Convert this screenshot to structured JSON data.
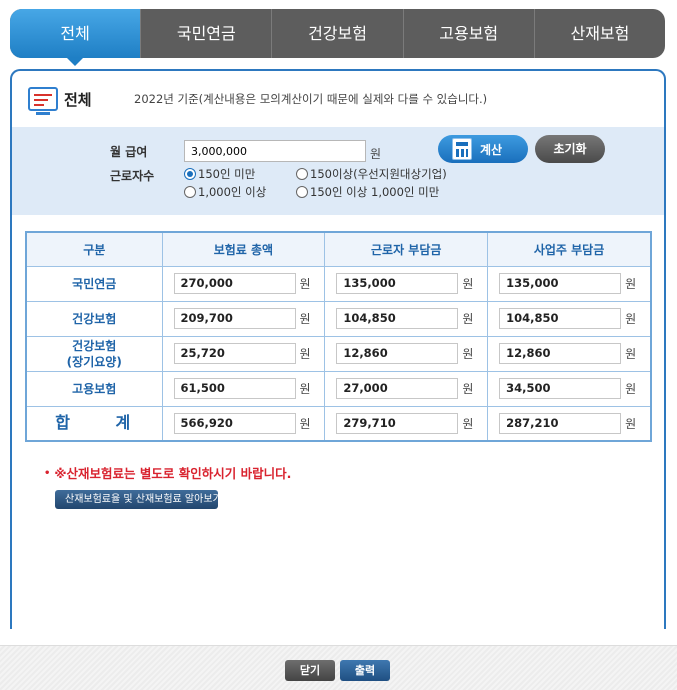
{
  "tabs": [
    {
      "label": "전체",
      "active": true
    },
    {
      "label": "국민연금"
    },
    {
      "label": "건강보험"
    },
    {
      "label": "고용보험"
    },
    {
      "label": "산재보험"
    }
  ],
  "panel": {
    "title": "전체",
    "note": "2022년 기준(계산내용은 모의계산이기 때문에 실제와 다를 수 있습니다.)"
  },
  "form": {
    "salary_label": "월 급여",
    "salary_value": "3,000,000",
    "currency": "원",
    "workers_label": "근로자수",
    "options": [
      {
        "label": "150인 미만",
        "checked": true
      },
      {
        "label": "150이상(우선지원대상기업)",
        "checked": false
      },
      {
        "label": "1,000인 이상",
        "checked": false
      },
      {
        "label": "150인 이상 1,000인 미만",
        "checked": false
      }
    ],
    "calc_button": "계산",
    "reset_button": "초기화"
  },
  "table": {
    "headers": [
      "구분",
      "보험료 총액",
      "근로자 부담금",
      "사업주 부담금"
    ],
    "unit": "원",
    "rows": [
      {
        "name": "국민연금",
        "total": "270,000",
        "worker": "135,000",
        "employer": "135,000"
      },
      {
        "name": "건강보험",
        "total": "209,700",
        "worker": "104,850",
        "employer": "104,850"
      },
      {
        "name": "건강보험",
        "sub": "(장기요양)",
        "total": "25,720",
        "worker": "12,860",
        "employer": "12,860"
      },
      {
        "name": "고용보험",
        "total": "61,500",
        "worker": "27,000",
        "employer": "34,500"
      },
      {
        "name": "합 계",
        "total": "566,920",
        "worker": "279,710",
        "employer": "287,210"
      }
    ]
  },
  "notice": {
    "bullet": "•",
    "text": "※산재보험료는 별도로 확인하시기 바랍니다."
  },
  "link_button": "산재보험료율 및 산재보험료 알아보기",
  "footer": {
    "close": "닫기",
    "print": "출력"
  },
  "colors": {
    "accent": "#2e8fd0",
    "tab_bg": "#5d5d5d",
    "notice": "#d9232f",
    "table_header_text": "#1f64a8"
  }
}
